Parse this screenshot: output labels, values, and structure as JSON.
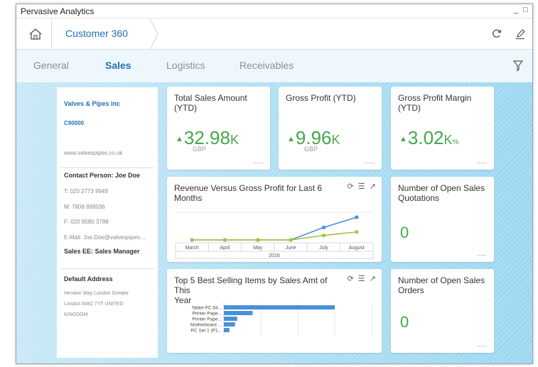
{
  "window": {
    "title": "Pervasive Analytics",
    "controls": [
      "_",
      "□"
    ]
  },
  "nav": {
    "breadcrumb": "Customer 360"
  },
  "tabs": [
    "General",
    "Sales",
    "Logistics",
    "Receivables"
  ],
  "active_tab": "Sales",
  "customer": {
    "name": "Valves & Pipes inc",
    "id": "C90000",
    "website": "www.valvespipes.co.uk",
    "contact_person": "Contact Person: Joe Doe",
    "phone": "T: 020 2773 9949",
    "mobile": "M: 7808 899036",
    "fax": "F: 020 8580 3788",
    "email": "E-Mail: Joe.Doe@valvespipes....",
    "sales_ee": "Sales EE: Sales Manager",
    "address_label": "Default Address",
    "address_line1": "Hendon Way London Greater",
    "address_line2": "London NW2 7YT UNITED",
    "address_line3": "KINGDOM"
  },
  "kpis": {
    "total_sales": {
      "title_line1": "Total Sales Amount",
      "title_line2": "(YTD)",
      "value": "32.98",
      "unit": "K",
      "currency": "GBP"
    },
    "gross_profit": {
      "title_line1": "Gross Profit (YTD)",
      "value": "9.96",
      "unit": "K",
      "currency": "GBP"
    },
    "gross_margin": {
      "title_line1": "Gross Profit Margin",
      "title_line2": "(YTD)",
      "value": "3.02",
      "unit": "K",
      "unit_suffix": "%"
    }
  },
  "revenue_chart": {
    "title_line1": "Revenue Versus Gross Profit for Last 6",
    "title_line2": "Months",
    "year": "2016"
  },
  "top5_chart": {
    "title_line1": "Top 5 Best Selling Items by Sales Amt of This",
    "title_line2": "Year"
  },
  "open_quotations": {
    "title_line1": "Number of Open Sales",
    "title_line2": "Quotations",
    "value": "0"
  },
  "open_orders": {
    "title_line1": "Number of Open Sales",
    "title_line2": "Orders",
    "value": "0"
  },
  "chart_data": [
    {
      "type": "line",
      "categories": [
        "March",
        "April",
        "May",
        "June",
        "July",
        "August"
      ],
      "series": [
        {
          "color": "#4a90d9",
          "values": [
            0,
            0,
            0,
            0,
            0.55,
            1.0
          ]
        },
        {
          "color": "#9dc73b",
          "values": [
            0,
            0,
            0,
            0,
            0.2,
            0.35
          ]
        }
      ]
    },
    {
      "type": "bar",
      "categories": [
        "Tablet PC 64...",
        "Printer Pape...",
        "Printer Pape...",
        "Motherboard ...",
        "PC Set 1 (P1..."
      ],
      "values": [
        100,
        26,
        12,
        10,
        5
      ],
      "color": "#4a90d9"
    }
  ],
  "colors": {
    "accent": "#1f6fb4",
    "kpi_green": "#42a84a",
    "series_blue": "#4a90d9",
    "series_green": "#9dc73b"
  }
}
